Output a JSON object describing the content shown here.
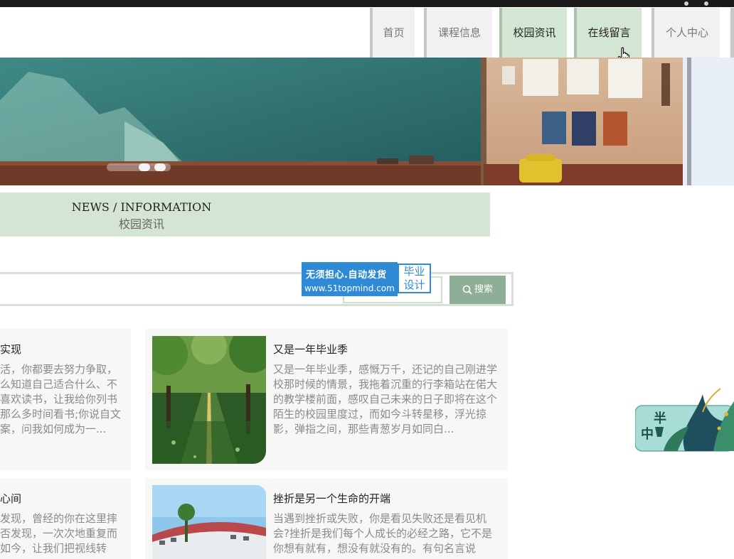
{
  "nav": {
    "items": [
      {
        "label": "首页",
        "active": false
      },
      {
        "label": "课程信息",
        "active": false
      },
      {
        "label": "校园资讯",
        "active": true
      },
      {
        "label": "在线留言",
        "active": true
      },
      {
        "label": "个人中心",
        "active": false
      }
    ]
  },
  "section": {
    "en": "NEWS / INFORMATION",
    "cn": "校园资讯"
  },
  "search": {
    "button_label": "搜索",
    "placeholder": ""
  },
  "watermark": {
    "line1": "无须担心.自动发货",
    "line2": "www.51topmind.com",
    "right_top": "毕业",
    "right_bottom": "设计"
  },
  "cards": [
    {
      "title": "实现",
      "text": "活，你都要去努力争取，么知道自己适合什么、不喜欢读书，让我给你列书那么多时间看书;你说自文案，问我如何成为一..."
    },
    {
      "title": "又是一年毕业季",
      "text": "又是一年毕业季，感慨万千，还记的自己刚进学校那时候的情景，我拖着沉重的行李箱站在偌大的教学楼前面，感叹自己未来的日子即将在这个陌生的校园里度过，而如今斗转星移，浮光掠影，弹指之间，那些青葱岁月如同白..."
    },
    {
      "title": "心间",
      "text": "发现，曾经的你在这里摔否发现，一次次地重复而如今，让我们把视线转"
    },
    {
      "title": "挫折是另一个生命的开端",
      "text": "当遇到挫折或失败，你是看见失败还是看见机会?挫折是我们每个人成长的必经之路，它不是你想有就有，想没有就没有的。有句名言说"
    }
  ],
  "deco": {
    "text1": "半",
    "text2": "中"
  },
  "colors": {
    "accent": "#d3e5d3",
    "button": "#8fae97",
    "watermark": "#2e8ad4"
  }
}
